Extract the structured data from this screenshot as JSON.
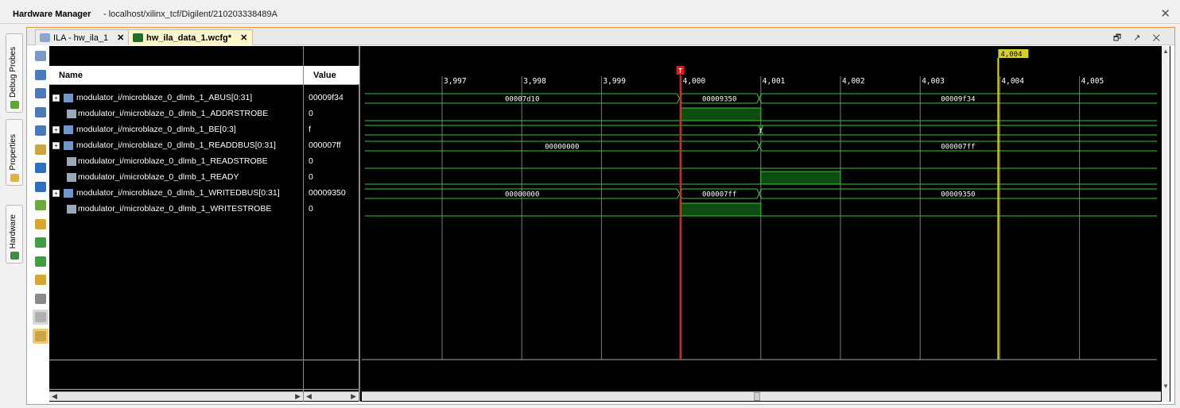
{
  "window": {
    "title": "Hardware Manager",
    "path": "- localhost/xilinx_tcf/Digilent/210203338489A",
    "close_glyph": "✕"
  },
  "side_tabs": [
    {
      "label": "Debug Probes",
      "icon": "probe-icon"
    },
    {
      "label": "Properties",
      "icon": "properties-icon"
    },
    {
      "label": "Hardware",
      "icon": "hardware-icon"
    }
  ],
  "tabs": [
    {
      "label": "ILA - hw_ila_1",
      "icon": "ila-icon",
      "close": "✕"
    },
    {
      "label": "hw_ila_data_1.wcfg*",
      "icon": "waveform-icon",
      "close": "✕"
    }
  ],
  "window_controls": "🗗 ↗ ✕",
  "toolbar": [
    "collapse-panel-icon",
    "save-icon",
    "zoom-in-icon",
    "zoom-out-icon",
    "zoom-fit-icon",
    "zoom-cursor-icon",
    "go-to-start-icon",
    "go-to-end-icon",
    "previous-transition-icon",
    "next-transition-icon",
    "add-marker-icon",
    "previous-marker-icon",
    "next-marker-icon",
    "swap-cursors-icon",
    "snap-to-transition-icon",
    "floating-ruler-icon"
  ],
  "columns": {
    "name": "Name",
    "value": "Value"
  },
  "signals": [
    {
      "name": "modulator_i/microblaze_0_dlmb_1_ABUS[0:31]",
      "value": "00009f34",
      "bus": true,
      "segments": [
        {
          "to": 3999.98,
          "label": "00007d10"
        },
        {
          "to": 4000.98,
          "label": "00009350"
        },
        {
          "to": 4006,
          "label": "00009f34"
        }
      ]
    },
    {
      "name": "modulator_i/microblaze_0_dlmb_1_ADDRSTROBE",
      "value": "0",
      "bus": false,
      "highs": [
        [
          4000,
          4001
        ]
      ]
    },
    {
      "name": "modulator_i/microblaze_0_dlmb_1_BE[0:3]",
      "value": "f",
      "bus": true,
      "segments": [
        {
          "to": 4006,
          "label": ""
        }
      ],
      "marks": [
        {
          "at": 4001,
          "label": "f"
        }
      ]
    },
    {
      "name": "modulator_i/microblaze_0_dlmb_1_READDBUS[0:31]",
      "value": "000007ff",
      "bus": true,
      "segments": [
        {
          "to": 4000.98,
          "label": "00000000"
        },
        {
          "to": 4006,
          "label": "000007ff"
        }
      ]
    },
    {
      "name": "modulator_i/microblaze_0_dlmb_1_READSTROBE",
      "value": "0",
      "bus": false,
      "highs": []
    },
    {
      "name": "modulator_i/microblaze_0_dlmb_1_READY",
      "value": "0",
      "bus": false,
      "highs": [
        [
          4001,
          4002
        ]
      ]
    },
    {
      "name": "modulator_i/microblaze_0_dlmb_1_WRITEDBUS[0:31]",
      "value": "00009350",
      "bus": true,
      "segments": [
        {
          "to": 3999.98,
          "label": "00000000"
        },
        {
          "to": 4000.98,
          "label": "000007ff"
        },
        {
          "to": 4006,
          "label": "00009350"
        }
      ]
    },
    {
      "name": "modulator_i/microblaze_0_dlmb_1_WRITESTROBE",
      "value": "0",
      "bus": false,
      "highs": [
        [
          4000,
          4001
        ]
      ]
    }
  ],
  "timeline": {
    "ticks": [
      "3,997",
      "3,998",
      "3,999",
      "4,000",
      "4,001",
      "4,002",
      "4,003",
      "4,004",
      "4,005"
    ],
    "trigger_label": "T",
    "trigger_at": 4000,
    "cursor_label": "4,004",
    "cursor_at": 4004
  },
  "colors": {
    "wave": "#3ec43e",
    "high_fill": "#0d4d12",
    "trigger": "#e01818",
    "cursor": "#e8e000",
    "grid": "#7a7a7a"
  }
}
